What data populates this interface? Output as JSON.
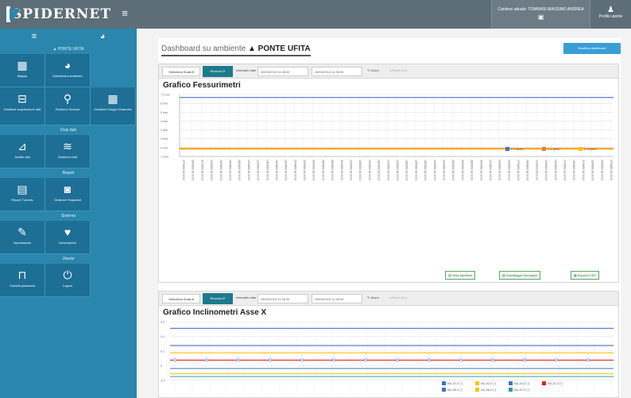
{
  "brand": {
    "name": "SPIDERNET"
  },
  "topbar": {
    "user_line1": "Cantiere attuale: TOMMASI MASSIMO ANDREA",
    "user_line2": "▣",
    "profile_label": "Profilo utente"
  },
  "sidebar": {
    "ambient": "▲ PONTE UFITA",
    "section_fissi": "Fissi dati",
    "section_report": "Report",
    "section_sistema": "Sistema",
    "section_utente": "Utente",
    "tiles": {
      "mappa": "Mappa",
      "dashboard": "Dashboard ambiente",
      "gestione_acq": "Gestione acquisizione dati",
      "gestione_sensori": "Gestione Sensori",
      "gestione_gruppi": "Gestione Gruppi Channels",
      "analisi_dati": "Analisi dati",
      "gestione_dati": "Gestione Dati",
      "report_tunnels": "Report Tunnels",
      "gestione_snapshot": "Gestione Snapshot",
      "impostazioni": "Impostazioni",
      "informazioni": "Informazioni",
      "cambia_password": "Cambia password",
      "logout": "Logout"
    }
  },
  "page": {
    "title_prefix": "Dashboard su ambiente",
    "ambient": "▲ PONTE UFITA",
    "modify_button": "Modifica dashboard"
  },
  "chart1": {
    "toolbar": {
      "select": "Seleziona Scala ▾",
      "refresh": "Ricarica ⟳",
      "interval": "Intervallo date",
      "date_from": "28/03/2018 11:38:00",
      "date_to": "28/04/2018 11:38:00",
      "zoom": "✎ Zoom",
      "reset": "◂ Reset (0h)"
    },
    "footer": {
      "b1": "▤ Vista tabellare",
      "b2": "▨ Salvataggio immagine",
      "b3": "▦ Esporta CSV"
    }
  },
  "chart2": {
    "toolbar": {
      "select": "Seleziona Scala ▾",
      "refresh": "Ricarica ⟳",
      "interval": "Intervallo date",
      "date_from": "28/03/2018 11:38:00",
      "date_to": "28/04/2018 11:38:00",
      "zoom": "✎ Zoom",
      "reset": "◂ Reset (0h)"
    }
  },
  "chart_data": [
    {
      "type": "line",
      "title": "Grafico Fessurimetri",
      "ylim": [
        -1,
        7.5
      ],
      "yticks": [
        "7.5 mm",
        "6 mm",
        "5 mm",
        "4 mm",
        "3 mm",
        "2 mm",
        "0 mm",
        "-1 mm"
      ],
      "series": [
        {
          "name": "F-1 (mm)",
          "color": "#4472c4",
          "values": [
            7.1,
            7.1
          ]
        },
        {
          "name": "F-2 (mm)",
          "color": "#ed7d31",
          "values": [
            0.1,
            0.1
          ]
        },
        {
          "name": "F-3 (mm)",
          "color": "#ffc000",
          "values": [
            0.0,
            0.0
          ]
        }
      ],
      "xlabels": [
        "27/03/2018 00:00",
        "29/03/2018 00:00",
        "31/03/2018 00:00",
        "02/04/2018 00:00",
        "04/04/2018 00:00",
        "06/04/2018 00:00",
        "08/04/2018 00:00",
        "10/04/2018 00:00",
        "12/04/2018 00:00",
        "14/04/2018 00:00",
        "16/04/2018 00:00",
        "18/04/2018 00:00",
        "20/04/2018 00:00",
        "22/04/2018 00:00",
        "24/04/2018 00:00",
        "26/04/2018 00:00",
        "28/04/2018 00:00",
        "30/04/2018 00:00",
        "02/05/2018 00:00",
        "04/05/2018 00:00",
        "06/05/2018 00:00",
        "08/05/2018 00:00",
        "10/05/2018 00:00",
        "12/05/2018 00:00",
        "14/05/2018 00:00",
        "16/05/2018 00:00",
        "18/05/2018 00:00",
        "20/05/2018 00:00",
        "22/05/2018 00:00",
        "24/05/2018 00:00",
        "26/05/2018 00:00",
        "28/05/2018 00:00",
        "30/05/2018 00:00",
        "01/06/2018 00:00",
        "03/06/2018 00:00",
        "05/06/2018 00:00",
        "07/06/2018 00:00",
        "09/06/2018 00:00",
        "11/06/2018 00:00",
        "13/06/2018 00:00",
        "15/06/2018 00:00",
        "17/06/2018 00:00",
        "19/06/2018 00:00",
        "21/06/2018 00:00",
        "23/06/2018 00:00",
        "25/06/2018 00:00",
        "27/06/2018 00:00"
      ]
    },
    {
      "type": "line",
      "title": "Grafico Inclinometri Asse X",
      "ylim": [
        -1,
        1
      ],
      "yticks": [
        "0.5",
        "0.3",
        "0.1",
        "0",
        "-0.1"
      ],
      "series": [
        {
          "name": "INL-07-X (°)",
          "color": "#4472c4",
          "values": [
            0.82,
            0.82
          ]
        },
        {
          "name": "INL-02-X (°)",
          "color": "#ffc000",
          "values": [
            0.15,
            0.15
          ]
        },
        {
          "name": "INL-03-X (°)",
          "color": "#4472c4",
          "values": [
            0.35,
            0.35
          ]
        },
        {
          "name": "INL-07-X (°)",
          "color": "#e02020",
          "values": [
            -0.05,
            -0.05
          ]
        },
        {
          "name": "INL-05-X (°)",
          "color": "#4472c4",
          "values": [
            -0.28,
            -0.28
          ]
        },
        {
          "name": "INL-06-X (°)",
          "color": "#ffc000",
          "values": [
            -0.42,
            -0.42
          ]
        },
        {
          "name": "INL-07-X (°)",
          "color": "#2aa0a0",
          "values": [
            -0.5,
            -0.5
          ]
        }
      ]
    }
  ]
}
